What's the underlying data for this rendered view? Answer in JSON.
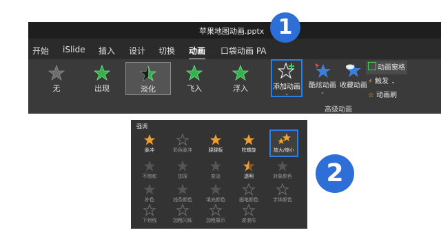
{
  "window": {
    "title": "苹果地图动画.pptx",
    "title_caret": "▾"
  },
  "tabs": [
    {
      "label": "开始"
    },
    {
      "label": "iSlide"
    },
    {
      "label": "插入"
    },
    {
      "label": "设计"
    },
    {
      "label": "切换"
    },
    {
      "label": "动画",
      "active": true
    },
    {
      "label": "口袋动画 PA"
    }
  ],
  "animations": [
    {
      "label": "无",
      "icon": "star-gray-icon"
    },
    {
      "label": "出现",
      "icon": "star-green-icon"
    },
    {
      "label": "淡化",
      "icon": "star-green-half-icon",
      "selected": true
    },
    {
      "label": "飞入",
      "icon": "star-green-icon"
    },
    {
      "label": "浮入",
      "icon": "star-green-icon"
    }
  ],
  "advanced": {
    "add_animation": "添加动画",
    "cool_animation": "酷炫动画",
    "collect_animation": "收藏动画",
    "pane": "动画窗格",
    "trigger": "触发",
    "painter": "动画刷",
    "group_label": "高级动画",
    "dropdown_glyph": "⌄"
  },
  "badges": {
    "one": "1",
    "two": "2"
  },
  "emphasis": {
    "header": "强调",
    "items": [
      {
        "label": "脉冲",
        "enabled": true
      },
      {
        "label": "彩色脉冲",
        "enabled": false
      },
      {
        "label": "跷跷板",
        "enabled": true
      },
      {
        "label": "陀螺旋",
        "enabled": true
      },
      {
        "label": "放大/缩小",
        "enabled": true,
        "selected": true
      },
      {
        "label": "不饱和",
        "enabled": false
      },
      {
        "label": "加深",
        "enabled": false
      },
      {
        "label": "变淡",
        "enabled": false
      },
      {
        "label": "透明",
        "enabled": true
      },
      {
        "label": "对象颜色",
        "enabled": false
      },
      {
        "label": "补色",
        "enabled": false
      },
      {
        "label": "线条颜色",
        "enabled": false
      },
      {
        "label": "填充颜色",
        "enabled": false
      },
      {
        "label": "画笔颜色",
        "enabled": false
      },
      {
        "label": "字体颜色",
        "enabled": false
      },
      {
        "label": "下划线",
        "enabled": false
      },
      {
        "label": "加粗闪烁",
        "enabled": false
      },
      {
        "label": "加粗展示",
        "enabled": false
      },
      {
        "label": "波浪形",
        "enabled": false
      }
    ]
  },
  "colors": {
    "accent": "#2f7fe6",
    "star_green": "#2fb34a",
    "star_gold": "#f0a030",
    "badge_blue": "#2d6fd6"
  }
}
